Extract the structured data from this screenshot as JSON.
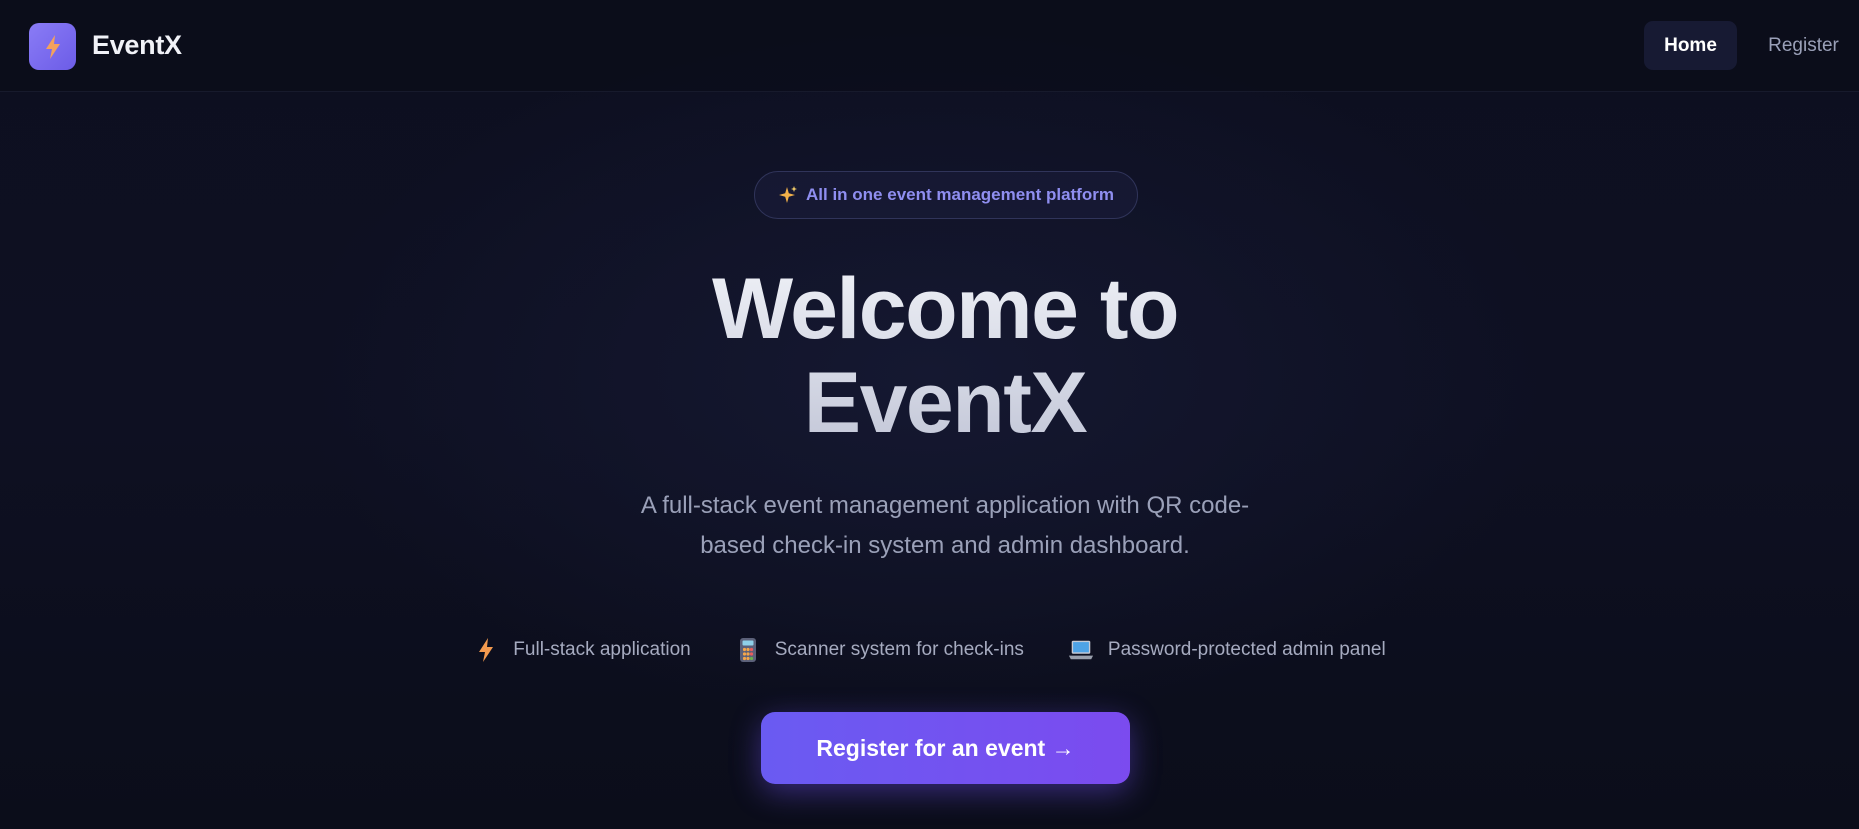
{
  "navbar": {
    "brand": "EventX",
    "logo_icon": "lightning-bolt-icon",
    "links": [
      {
        "label": "Home",
        "active": true
      },
      {
        "label": "Register",
        "active": false
      }
    ]
  },
  "hero": {
    "badge": {
      "icon": "sparkles-icon",
      "text": "All in one event management platform"
    },
    "title_line1": "Welcome to",
    "title_line2": "EventX",
    "subtitle_line1": "A full-stack event management application with QR code-",
    "subtitle_line2": "based check-in system and admin dashboard.",
    "features": [
      {
        "icon": "lightning-bolt-icon",
        "label": "Full-stack application"
      },
      {
        "icon": "calculator-icon",
        "label": "Scanner system for check-ins"
      },
      {
        "icon": "laptop-icon",
        "label": "Password-protected admin panel"
      }
    ],
    "cta_label": "Register for an event →"
  },
  "colors": {
    "background": "#0d0f1e",
    "accent": "#6a5bf2",
    "accent_end": "#7b4bef",
    "text_muted": "#9aa0b8"
  }
}
